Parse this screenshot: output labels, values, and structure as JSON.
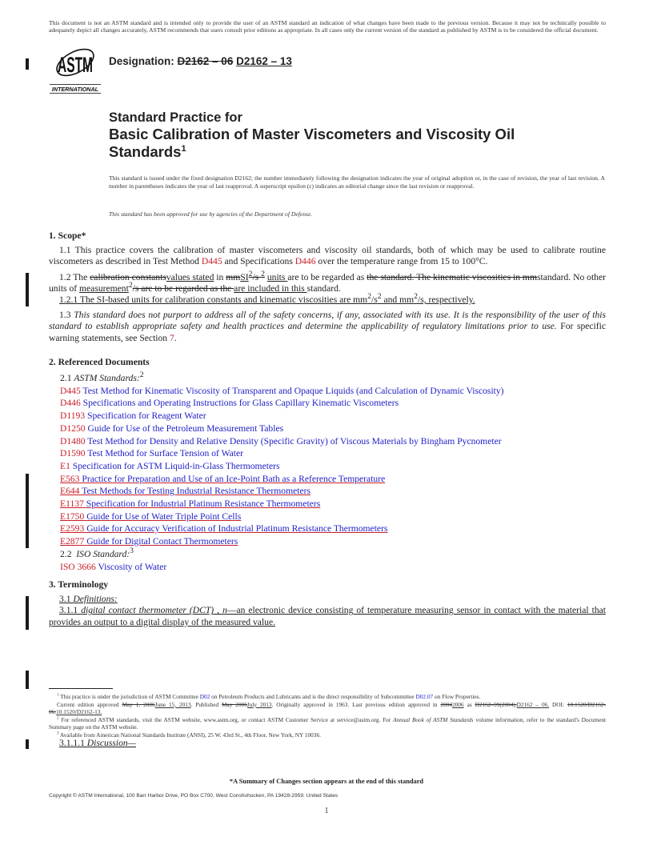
{
  "notice": "This document is not an ASTM standard and is intended only to provide the user of an ASTM standard an indication of what changes have been made to the previous version. Because it may not be technically possible to adequately depict all changes accurately, ASTM recommends that users consult prior editions as appropriate. In all cases only the current version of the standard as published by ASTM is to be considered the official document.",
  "logo": {
    "text": "ASTM",
    "subtext": "INTERNATIONAL"
  },
  "designation": {
    "label": "Designation: ",
    "old": "D2162 – 06",
    "new": "D2162 – 13"
  },
  "title": {
    "line1": "Standard Practice for",
    "line2": "Basic Calibration of Master Viscometers and Viscosity Oil",
    "line3": "Standards",
    "footnote_mark": "1"
  },
  "issued_text": "This standard is issued under the fixed designation D2162; the number immediately following the designation indicates the year of original adoption or, in the case of revision, the year of last revision. A number in parentheses indicates the year of last reapproval. A superscript epsilon (ε) indicates an editorial change since the last revision or reapproval.",
  "approved_text": "This standard has been approved for use by agencies of the Department of Defense.",
  "scope": {
    "heading": "1. Scope*",
    "p1_1": "1.1 This practice covers the calibration of master viscometers and viscosity oil standards, both of which may be used to calibrate routine viscometers as described in Test Method ",
    "p1_link1": "D445",
    "p1_2": " and Specifications ",
    "p1_link2": "D446",
    "p1_3": " over the temperature range from 15 to 100°C.",
    "p2": {
      "a": "1.2 The ",
      "del1": "calibration constants",
      "ins1": "values stated",
      "b": " in ",
      "del2": "mm",
      "ins2": "SI",
      "sup1": "2",
      "del3": "/s ",
      "sup2": "2",
      "c": " ",
      "ins3": "units ",
      "d": "are to be regarded as ",
      "del4": "the standard. The kinematic viscosities in mm",
      "e": "standard. No other units of ",
      "ins4": "measurement",
      "sup3": "2",
      "del5": "/s are to be regarded as the ",
      "ins5": "are included in this ",
      "f": "standard."
    },
    "p2_1": {
      "a": "1.2.1 The SI-based units for calibration constants and kinematic viscosities are mm",
      "sup1": "2",
      "b": "/s",
      "sup2": "2",
      "c": " and mm",
      "sup3": "2",
      "d": "/s, respectively."
    },
    "p3_num": "1.3 ",
    "p3_italic": "This standard does not purport to address all of the safety concerns, if any, associated with its use. It is the responsibility of the user of this standard to establish appropriate safety and health practices and determine the applicability of regulatory limitations prior to use.",
    "p3_rest": " For specific warning statements, see Section ",
    "p3_link": "7",
    "p3_end": "."
  },
  "references": {
    "heading": "2. Referenced Documents",
    "sub1_num": "2.1 ",
    "sub1_label": "ASTM Standards:",
    "sub1_sup": "2",
    "astm": [
      {
        "code": "D445",
        "title": "Test Method for Kinematic Viscosity of Transparent and Opaque Liquids (and Calculation of Dynamic Viscosity)",
        "inserted": false
      },
      {
        "code": "D446",
        "title": "Specifications and Operating Instructions for Glass Capillary Kinematic Viscometers",
        "inserted": false
      },
      {
        "code": "D1193",
        "title": "Specification for Reagent Water",
        "inserted": false
      },
      {
        "code": "D1250",
        "title": "Guide for Use of the Petroleum Measurement Tables",
        "inserted": false
      },
      {
        "code": "D1480",
        "title": "Test Method for Density and Relative Density (Specific Gravity) of Viscous Materials by Bingham Pycnometer",
        "inserted": false
      },
      {
        "code": "D1590",
        "title": "Test Method for Surface Tension of Water",
        "inserted": false
      },
      {
        "code": "E1",
        "title": "Specification for ASTM Liquid-in-Glass Thermometers",
        "inserted": false
      },
      {
        "code": "E563",
        "title": "Practice for Preparation and Use of an Ice-Point Bath as a Reference Temperature",
        "inserted": true
      },
      {
        "code": "E644",
        "title": "Test Methods for Testing Industrial Resistance Thermometers",
        "inserted": true
      },
      {
        "code": "E1137",
        "title": "Specification for Industrial Platinum Resistance Thermometers",
        "inserted": true
      },
      {
        "code": "E1750",
        "title": "Guide for Use of Water Triple Point Cells",
        "inserted": true
      },
      {
        "code": "E2593",
        "title": "Guide for Accuracy Verification of Industrial Platinum Resistance Thermometers",
        "inserted": true
      },
      {
        "code": "E2877",
        "title": "Guide for Digital Contact Thermometers",
        "inserted": true
      }
    ],
    "sub2_num": "2.2 ",
    "sub2_label": "ISO Standard:",
    "sub2_sup": "3",
    "iso": [
      {
        "code": "ISO 3666",
        "title": "Viscosity of Water"
      }
    ]
  },
  "terminology": {
    "heading": "3. Terminology",
    "def_num": "3.1 ",
    "def_label": "Definitions:",
    "term_num": "3.1.1 ",
    "term_name": "digital contact thermometer (DCT)",
    "term_sep": " , ",
    "term_pos": "n",
    "term_def": "—an electronic device consisting of temperature measuring sensor in contact with the material that provides an output to a digital display of the measured value.",
    "discussion_num": "3.1.1.1 ",
    "discussion_label": "Discussion—"
  },
  "footnotes": {
    "f1": {
      "mark": "1",
      "a": " This practice is under the jurisdiction of ASTM Committee ",
      "link1": "D02",
      "b": " on Petroleum Products and Lubricants and is the direct responsibility of Subcommittee ",
      "link2": "D02.07",
      "c": " on Flow Properties."
    },
    "f1b": {
      "a": "Current edition approved ",
      "del1": "May 1, 2006",
      "ins1": "June 15, 2013",
      "b": ". Published ",
      "del2": "May 2006",
      "ins2": "July 2013",
      "c": ". Originally approved in 1963. Last previous edition approved in ",
      "del3": "2004",
      "ins3": "2006",
      "d": " as ",
      "del4": "D2162–99(2004).",
      "ins4": "D2162 – 06.",
      "e": " DOI: ",
      "del5": "10.1520/D2162-06.",
      "ins5": "10.1520/D2162-13."
    },
    "f2": {
      "mark": "2",
      "a": " For referenced ASTM standards, visit the ASTM website, www.astm.org, or contact ASTM Customer Service at service@astm.org. For ",
      "italic": "Annual Book of ASTM Standards",
      "b": " volume information, refer to the standard's Document Summary page on the ASTM website."
    },
    "f3": {
      "mark": "3",
      "a": " Available from American National Standards Institute (ANSI), 25 W. 43rd St., 4th Floor, New York, NY 10036."
    }
  },
  "summary_note": "*A Summary of Changes section appears at the end of this standard",
  "copyright": "Copyright © ASTM International, 100 Barr Harbor Drive, PO Box C700, West Conshohocken, PA 19428-2959. United States",
  "page_number": "1",
  "colors": {
    "link_code": "#c8202a",
    "link_title": "#2020c8",
    "change_bar": "#1a1a1a"
  }
}
